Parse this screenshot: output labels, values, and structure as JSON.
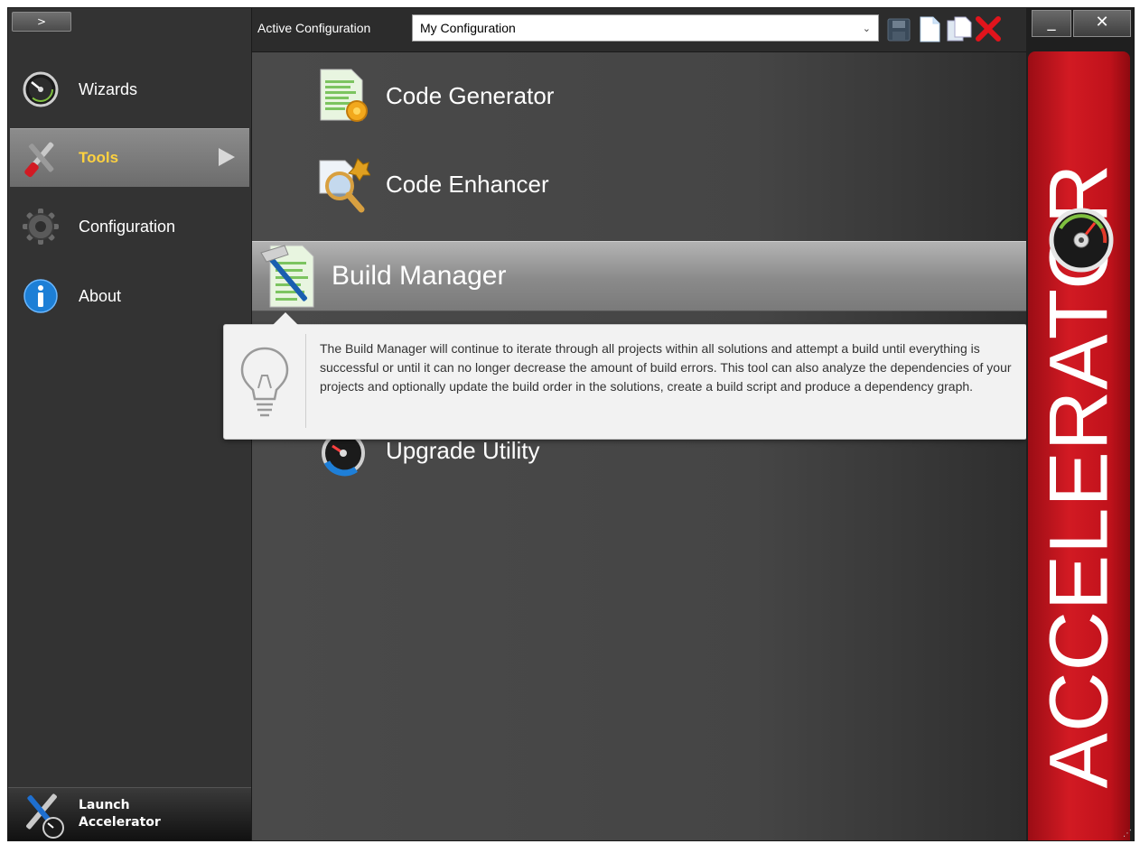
{
  "sidebar": {
    "collapse_label": ">",
    "items": [
      {
        "label": "Wizards",
        "icon": "gauge-icon"
      },
      {
        "label": "Tools",
        "icon": "tools-icon",
        "active": true
      },
      {
        "label": "Configuration",
        "icon": "gear-icon"
      },
      {
        "label": "About",
        "icon": "info-icon"
      }
    ],
    "launch_line1": "Launch",
    "launch_line2": "Accelerator"
  },
  "toolbar": {
    "config_label": "Active Configuration",
    "config_value": "My Configuration",
    "icons": [
      "save-icon",
      "new-document-icon",
      "copy-icon",
      "delete-icon"
    ]
  },
  "tools": [
    {
      "label": "Code Generator",
      "icon": "code-generator-icon"
    },
    {
      "label": "Code Enhancer",
      "icon": "code-enhancer-icon"
    },
    {
      "label": "Build Manager",
      "icon": "build-manager-icon",
      "active": true
    },
    {
      "label": "Upgrade Utility",
      "icon": "upgrade-utility-icon"
    }
  ],
  "tooltip": {
    "text": "The Build Manager will continue to iterate through all projects within all solutions and attempt a build until everything is successful or until it can no longer decrease the amount of build errors. This tool can also analyze the dependencies of your projects and optionally update the build order in the solutions, create a build script and produce a dependency graph."
  },
  "window": {
    "minimize_label": "_",
    "close_label": "✕"
  },
  "brand": {
    "text": "ACCELERATOR",
    "color": "#c8111a"
  }
}
